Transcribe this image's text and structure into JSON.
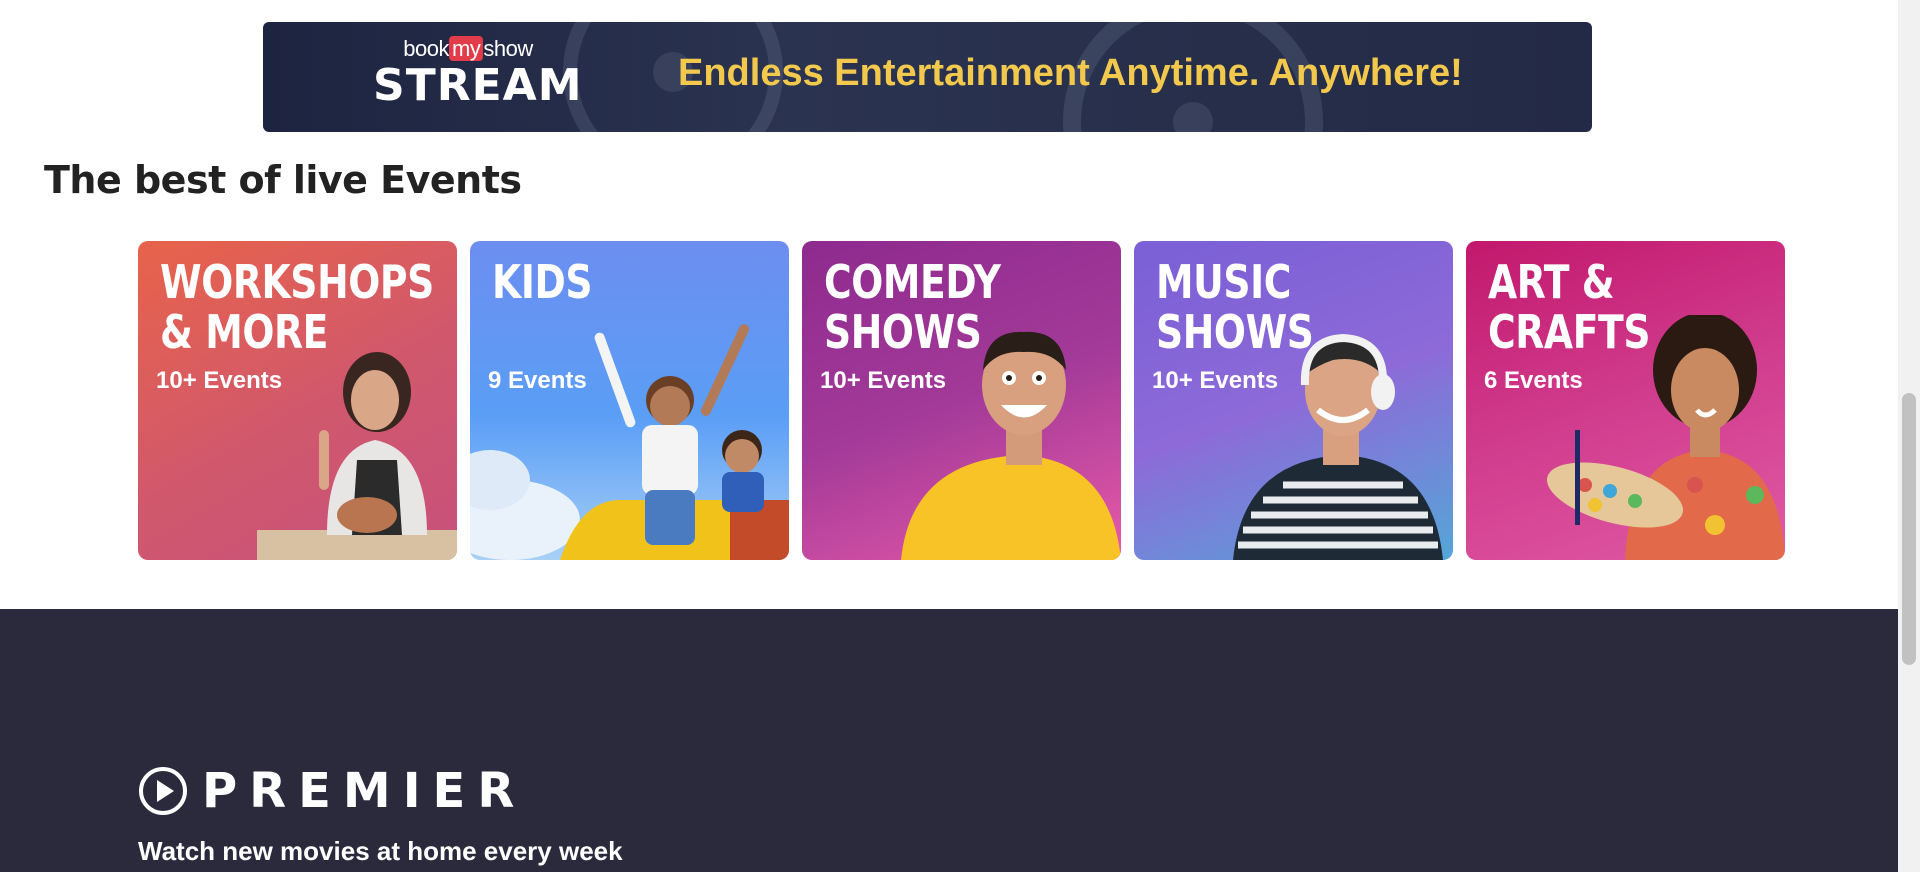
{
  "banner": {
    "logo_small_1": "book",
    "logo_small_2": "my",
    "logo_small_3": "show",
    "logo_big": "STREAM",
    "tagline": "Endless Entertainment Anytime. Anywhere!"
  },
  "section": {
    "title": "The best of live Events"
  },
  "categories": [
    {
      "title_line1": "WORKSHOPS",
      "title_line2": "& MORE",
      "count": "10+ Events"
    },
    {
      "title_line1": "KIDS",
      "title_line2": "",
      "count": "9 Events"
    },
    {
      "title_line1": "COMEDY",
      "title_line2": "SHOWS",
      "count": "10+ Events"
    },
    {
      "title_line1": "MUSIC",
      "title_line2": "SHOWS",
      "count": "10+ Events"
    },
    {
      "title_line1": "ART &",
      "title_line2": "CRAFTS",
      "count": "6 Events"
    }
  ],
  "premier": {
    "brand": "PREMIER",
    "subtitle": "Watch new movies at home every week"
  },
  "colors": {
    "tagline": "#f2c94c",
    "footer_bg": "#2b2a3d",
    "brand_red": "#e23b4a"
  },
  "icons": {
    "premier_logo": "play-circle-icon"
  }
}
